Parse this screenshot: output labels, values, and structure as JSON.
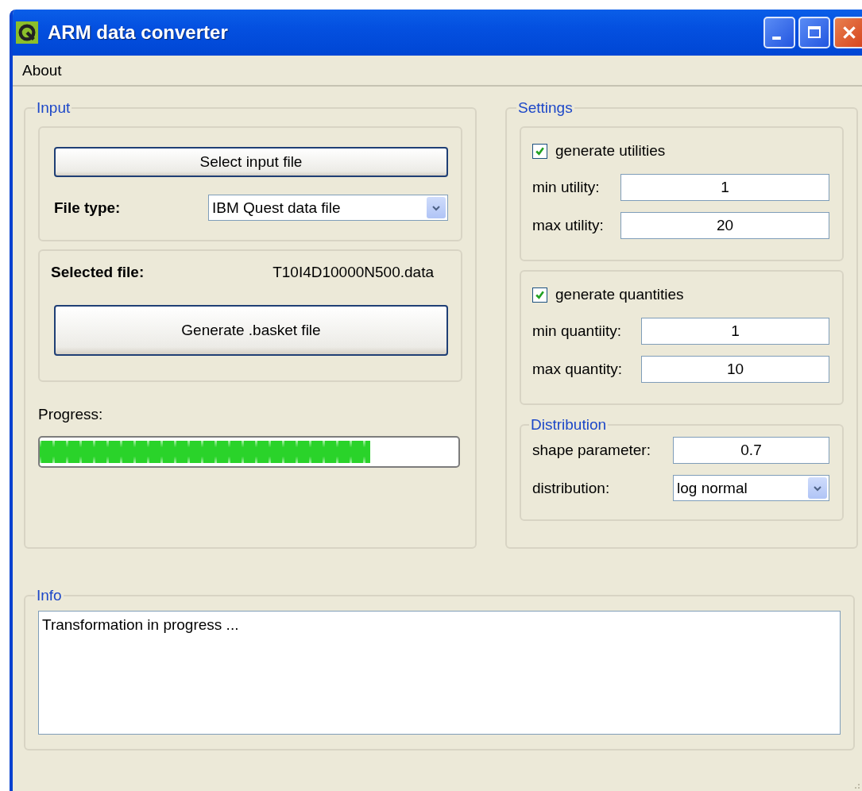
{
  "window": {
    "title": "ARM data converter"
  },
  "menu": [
    "About"
  ],
  "input": {
    "title": "Input",
    "select_button": "Select input file",
    "file_type_label": "File type:",
    "file_type": "IBM Quest data file",
    "selected_file_label": "Selected file:",
    "selected_file": "T10I4D10000N500.data",
    "generate_button": "Generate .basket file",
    "progress_label": "Progress:",
    "progress": {
      "level": 0.79
    }
  },
  "settings": {
    "title": "Settings",
    "groups": [
      {
        "label": "generate utilities",
        "checked": true,
        "fields": [
          {
            "label": "min utility:",
            "value": "1"
          },
          {
            "label": "max utility:",
            "value": "20"
          }
        ]
      },
      {
        "label": "generate quantities",
        "checked": true,
        "fields": [
          {
            "label": "min quantiity:",
            "value": "1"
          },
          {
            "label": "max quantity:",
            "value": "10"
          }
        ]
      }
    ],
    "distribution": {
      "title": "Distribution",
      "shape_label": "shape parameter:",
      "shape_value": "0.7",
      "distribution_label": "distribution:",
      "distribution_value": "log normal"
    }
  },
  "info": {
    "title": "Info",
    "text": "Transformation in progress ..."
  }
}
